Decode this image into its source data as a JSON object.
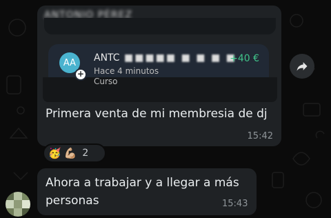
{
  "message1": {
    "blurred_header": "ANTONIO PÉREZ",
    "card": {
      "avatar_initials": "AA",
      "name_prefix": "ANTC",
      "name_blurred": "■■■■■ ■ ■ ■ ■",
      "time_ago": "Hace 4 minutos",
      "type": "Curso",
      "amount": "+40 €",
      "amount_color": "#40c48a",
      "plus_icon": "plus-icon"
    },
    "text": "Primera venta de mi membresia de dj",
    "time": "15:42"
  },
  "forward_icon": "forward-arrow-icon",
  "reactions": {
    "emoji_1": "🥳",
    "emoji_2": "💪🏼",
    "count": "2"
  },
  "message2": {
    "text": "Ahora a trabajar y a llegar a más personas",
    "time": "15:43"
  },
  "sender_avatar_icon": "pixelated-avatar"
}
